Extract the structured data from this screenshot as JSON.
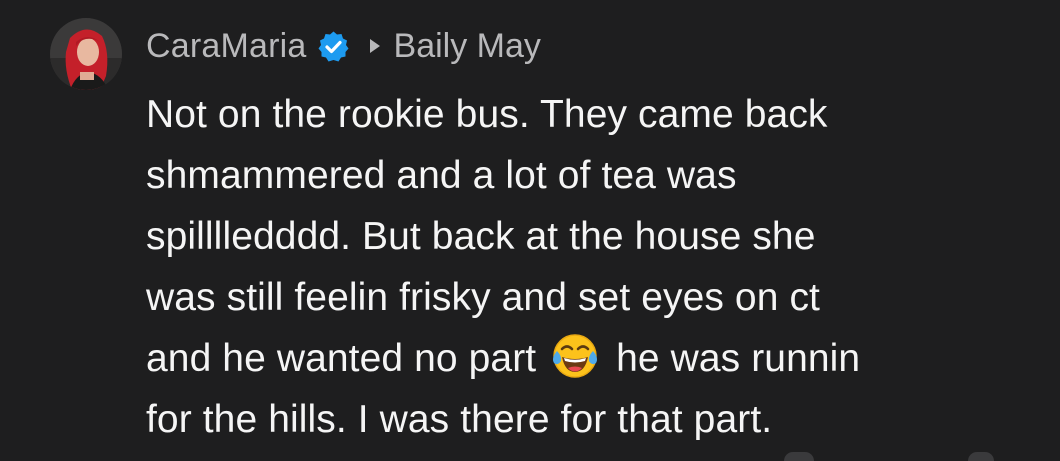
{
  "comment": {
    "author": "CaraMaria",
    "author_verified": true,
    "reply_arrow": "reply-triangle-icon",
    "replied_to": "Baily May",
    "avatar_icon": "user-avatar",
    "lines": [
      {
        "text": "Not on the rookie bus. They came back"
      },
      {
        "text": "shmammered and a lot of tea was"
      },
      {
        "text": "spilllledddd. But back at the house she"
      },
      {
        "text": "was still feelin frisky and set eyes on ct"
      },
      {
        "before": "and he wanted no part",
        "emoji": "face-with-tears-of-joy-emoji",
        "after": "he was runnin"
      },
      {
        "text": "for the hills. I was there for that part."
      }
    ]
  },
  "colors": {
    "background": "#1e1e1f",
    "text": "#f5f5f5",
    "meta_text": "#b9b9bb",
    "verified_badge": "#1d9bf0"
  }
}
